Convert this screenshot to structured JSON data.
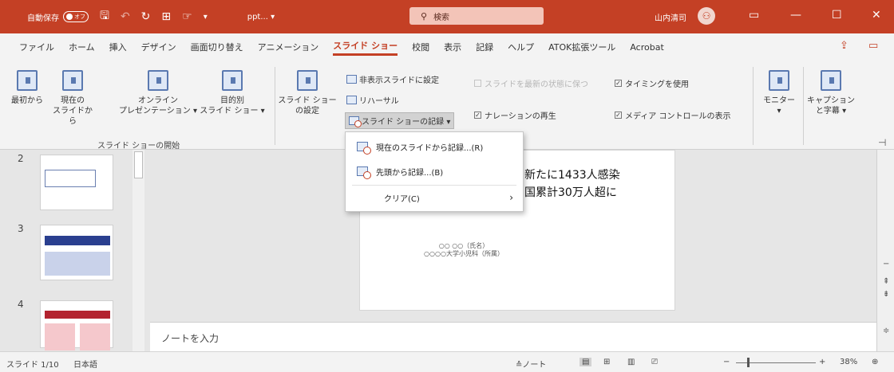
{
  "titlebar": {
    "autosave_label": "自動保存",
    "autosave_state": "オフ",
    "filename": "ppt...  ▾",
    "search_placeholder": "検索",
    "user_name": "山内清司",
    "icons": [
      "save-icon",
      "undo-icon",
      "redo-icon",
      "present-icon",
      "touch-icon",
      "customize-icon"
    ],
    "window_buttons": [
      "▭",
      "—",
      "☐",
      "✕"
    ],
    "accent_color": "#c44025"
  },
  "tabs": {
    "items": [
      "ファイル",
      "ホーム",
      "挿入",
      "デザイン",
      "画面切り替え",
      "アニメーション",
      "スライド ショー",
      "校閲",
      "表示",
      "記録",
      "ヘルプ",
      "ATOK拡張ツール",
      "Acrobat"
    ],
    "active": "スライド ショー"
  },
  "ribbon": {
    "from_beginning": "最初から",
    "from_current_line1": "現在の",
    "from_current_line2": "スライドから",
    "online_line1": "オンライン",
    "online_line2": "プレゼンテーション ▾",
    "custom_line1": "目的別",
    "custom_line2": "スライド ショー ▾",
    "group_start": "スライド ショーの開始",
    "setup_line1": "スライド ショー",
    "setup_line2": "の設定",
    "hide_slide": "非表示スライドに設定",
    "rehearse": "リハーサル",
    "record": "スライド ショーの記録 ▾",
    "keep_updated": "スライドを最新の状態に保つ",
    "narration": "ナレーションの再生",
    "use_timings": "タイミングを使用",
    "media_controls": "メディア コントロールの表示",
    "monitor_line1": "モニター",
    "monitor_line2": "▾",
    "captions_line1": "キャプション",
    "captions_line2": "と字幕 ▾"
  },
  "slides": {
    "numbers": [
      "2",
      "3",
      "4"
    ],
    "current_title_line1": "新たに1433人感染",
    "current_title_line2": "国累計30万人超に",
    "person_line1": "○○ ○○（氏名）",
    "person_line2": "○○○○大学小児科（所属）"
  },
  "menu": {
    "items": [
      {
        "label": "現在のスライドから記録...(R)"
      },
      {
        "label": "先頭から記録...(B)"
      },
      {
        "label": "クリア(C)"
      }
    ],
    "submenu_arrow": "›"
  },
  "notes_placeholder": "ノートを入力",
  "statusbar": {
    "slide_info": "スライド 1/10",
    "language": "日本語",
    "notes_button": "≙ノート",
    "zoom_minus": "−",
    "zoom_plus": "+",
    "zoom": "38%"
  }
}
